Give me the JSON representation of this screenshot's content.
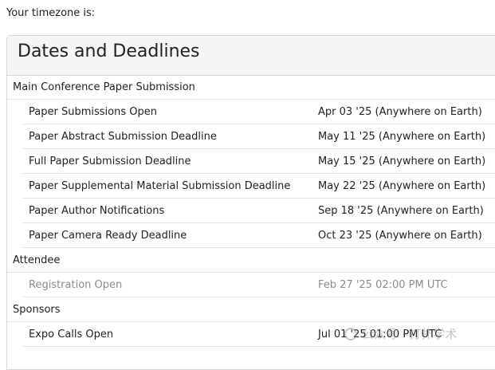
{
  "timezone_label": "Your timezone is:",
  "panel": {
    "title": "Dates and Deadlines"
  },
  "sections": [
    {
      "name": "Main Conference Paper Submission",
      "items": [
        {
          "label": "Paper Submissions Open",
          "value": "Apr 03 '25 (Anywhere on Earth)"
        },
        {
          "label": "Paper Abstract Submission Deadline",
          "value": "May 11 '25 (Anywhere on Earth)"
        },
        {
          "label": "Full Paper Submission Deadline",
          "value": "May 15 '25 (Anywhere on Earth)"
        },
        {
          "label": "Paper Supplemental Material Submission Deadline",
          "value": "May 22 '25 (Anywhere on Earth)"
        },
        {
          "label": "Paper Author Notifications",
          "value": "Sep 18 '25 (Anywhere on Earth)"
        },
        {
          "label": "Paper Camera Ready Deadline",
          "value": "Oct 23 '25 (Anywhere on Earth)"
        }
      ]
    },
    {
      "name": "Attendee",
      "items": [
        {
          "label": "Registration Open",
          "value": "Feb 27 '25 02:00 PM UTC",
          "muted": true
        }
      ]
    },
    {
      "name": "Sponsors",
      "items": [
        {
          "label": "Expo Calls Open",
          "value": "Jul 01 '25 01:00 PM UTC"
        }
      ]
    }
  ],
  "watermark": {
    "text": "公众号 · 打扑学术"
  }
}
